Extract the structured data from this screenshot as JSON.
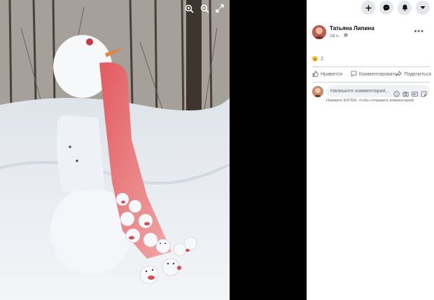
{
  "post": {
    "author": "Татьяна Липина",
    "time": "18 ч.",
    "privacy_icon": "globe-icon",
    "reaction_icon": "haha-emoji-icon",
    "reaction_count": "2"
  },
  "actions": {
    "like": "Нравится",
    "comment": "Комментировать",
    "share": "Поделиться"
  },
  "comment": {
    "placeholder": "Напишите комментарий...",
    "hint": "Нажмите ENTER, чтобы отправить комментарий."
  },
  "viewer_tools": [
    "zoom-in-icon",
    "zoom-out-icon",
    "fullscreen-icon"
  ],
  "top_actions": [
    "plus-icon",
    "messenger-icon",
    "notifications-icon",
    "account-menu-icon"
  ],
  "colors": {
    "panel_bg": "#ffffff",
    "viewer_bg": "#000000",
    "secondary_text": "#65676b",
    "button_bg": "#e4e6eb"
  }
}
